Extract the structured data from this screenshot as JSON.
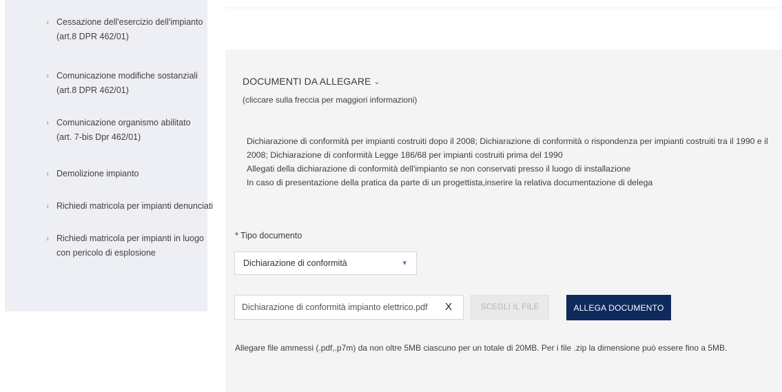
{
  "sidebar": {
    "items": [
      {
        "label": "Cessazione dell'esercizio dell'impianto (art.8 DPR 462/01)"
      },
      {
        "label": "Comunicazione modifiche sostanziali (art.8 DPR 462/01)"
      },
      {
        "label": "Comunicazione organismo abilitato (art. 7-bis Dpr 462/01)"
      },
      {
        "label": "Demolizione impianto"
      },
      {
        "label": "Richiedi matricola per impianti denunciati"
      },
      {
        "label": "Richiedi matricola per impianti in luogo con pericolo di esplosione"
      }
    ]
  },
  "documents": {
    "title": "DOCUMENTI DA ALLEGARE",
    "hint": "(cliccare sulla freccia per maggiori informazioni)",
    "lines": [
      "Dichiarazione di conformità per impianti costruiti dopo il 2008; Dichiarazione di conformità o rispondenza per impianti costruiti tra il 1990 e il 2008; Dichiarazione di conformità Legge 186/68 per impianti costruiti prima del 1990",
      "Allegati della dichiarazione di conformità dell'impianto se non conservati presso il luogo di installazione",
      "In caso di presentazione della pratica da parte di un progettista,inserire la relativa documentazione di delega"
    ]
  },
  "form": {
    "type_label": "* Tipo documento",
    "type_value": "Dichiarazione di conformità",
    "file_name": "Dichiarazione di conformità impianto elettrico.pdf",
    "clear_symbol": "X",
    "choose_label": "SCEGLI IL FILE",
    "attach_label": "ALLEGA DOCUMENTO",
    "note": "Allegare file ammessi (.pdf,.p7m) da non oltre 5MB ciascuno per un totale di 20MB. Per i file .zip la dimensione può essere fino a 5MB."
  },
  "icons": {
    "sidebar_chevron": "chevron-right-icon",
    "title_chevron": "chevron-down-icon",
    "select_chevron": "chevron-down-icon",
    "clear": "close-icon"
  },
  "colors": {
    "sidebar_bg": "#eeeff4",
    "panel_bg": "#f4f4f4",
    "primary_button": "#0f2a5c",
    "select_chevron": "#4a78b8"
  }
}
